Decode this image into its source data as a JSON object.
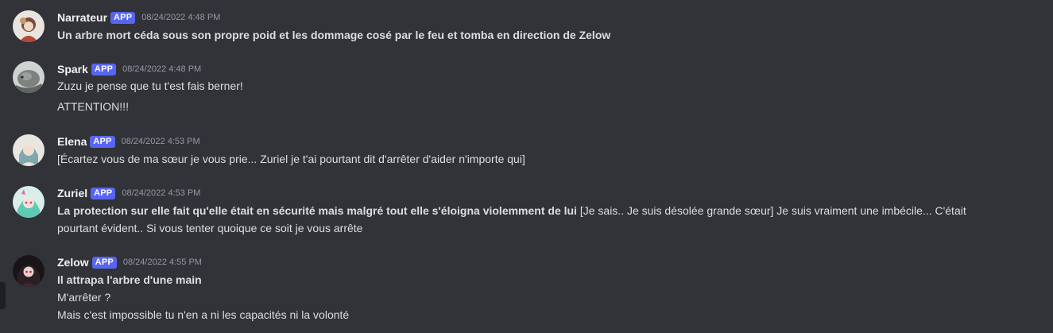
{
  "messages": [
    {
      "username": "Narrateur",
      "badge": "APP",
      "timestamp": "08/24/2022 4:48 PM",
      "avatar_icon": "anime-girl-avatar",
      "lines": [
        {
          "bold": "Un arbre mort céda sous son propre poid et les dommage cosé par le feu et tomba en direction de Zelow"
        }
      ]
    },
    {
      "username": "Spark",
      "badge": "APP",
      "timestamp": "08/24/2022 4:48 PM",
      "avatar_icon": "creature-avatar",
      "lines": [
        {
          "text": "Zuzu je pense que tu t'est fais berner!"
        },
        {
          "text": "ATTENTION!!!"
        }
      ]
    },
    {
      "username": "Elena",
      "badge": "APP",
      "timestamp": "08/24/2022 4:53 PM",
      "avatar_icon": "anime-girl-avatar",
      "lines": [
        {
          "text": "[Écartez vous de ma sœur je vous prie... Zuriel je t'ai pourtant dit d'arrêter d'aider n'importe qui]"
        }
      ]
    },
    {
      "username": "Zuriel",
      "badge": "APP",
      "timestamp": "08/24/2022 4:53 PM",
      "avatar_icon": "anime-girl-avatar",
      "lines": [
        {
          "bold": "La protection sur elle fait qu'elle était en sécurité mais malgré tout elle s'éloigna violemment de lui",
          "text": " [Je sais.. Je suis désolée grande sœur] Je suis vraiment une imbécile... C'était"
        },
        {
          "text": "pourtant évident.. Si vous tenter quoique ce soit je vous arrête"
        }
      ]
    },
    {
      "username": "Zelow",
      "badge": "APP",
      "timestamp": "08/24/2022 4:55 PM",
      "avatar_icon": "dark-character-avatar",
      "lines": [
        {
          "bold": "Il attrapa l'arbre d'une main"
        },
        {
          "text": "M'arrêter ?"
        },
        {
          "text": "Mais c'est impossible tu n'en a ni les capacités ni la volonté"
        }
      ]
    }
  ],
  "colors": {
    "background": "#313338",
    "badge": "#5865f2",
    "username": "#f2f3f5",
    "text": "#dbdee1",
    "timestamp": "#949ba4"
  }
}
